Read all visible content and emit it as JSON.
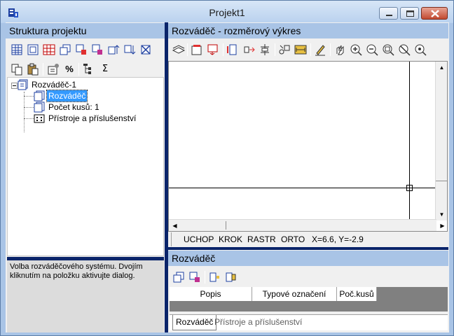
{
  "window": {
    "title": "Projekt1",
    "app_icon": "app-logo-icon"
  },
  "left_panel": {
    "title": "Struktura projektu",
    "toolbar_row1": [
      "table-grid-icon",
      "frame-icon",
      "red-grid-icon",
      "copy-frames-icon",
      "frame-red-icon",
      "frame-blue-icon",
      "move-up-icon",
      "move-down-icon",
      "delete-frame-icon"
    ],
    "toolbar_row2": [
      "copy-icon",
      "paste-icon",
      "properties-icon",
      "percent-icon",
      "tree-settings-icon",
      "sum-icon"
    ],
    "percent_label": "%",
    "sum_label": "Σ",
    "tree": [
      {
        "label": "Rozváděč-1",
        "level": 0,
        "selected": false,
        "icon": "switchboard-icon"
      },
      {
        "label": "Rozváděč",
        "level": 1,
        "selected": true,
        "icon": "switchboard-icon"
      },
      {
        "label": "Počet kusů: 1",
        "level": 1,
        "selected": false,
        "icon": "switchboard-icon"
      },
      {
        "label": "Přístroje a příslušenství",
        "level": 1,
        "selected": false,
        "icon": "devices-icon"
      }
    ],
    "description": "Volba rozváděčového systému. Dvojím kliknutím na položku aktivujte dialog."
  },
  "drawing_panel": {
    "title": "Rozváděč - rozměrový výkres",
    "status": {
      "uchop": "UCHOP",
      "krok": "KROK",
      "rastr": "RASTR",
      "orto": "ORTO",
      "coords": "X=6.6, Y=-2.9"
    }
  },
  "bottom_panel": {
    "title": "Rozváděč",
    "columns": [
      "Popis",
      "Typové označení",
      "Poč.kusů"
    ],
    "tabs": [
      "Rozváděč",
      "Přístroje a příslušenství"
    ]
  }
}
